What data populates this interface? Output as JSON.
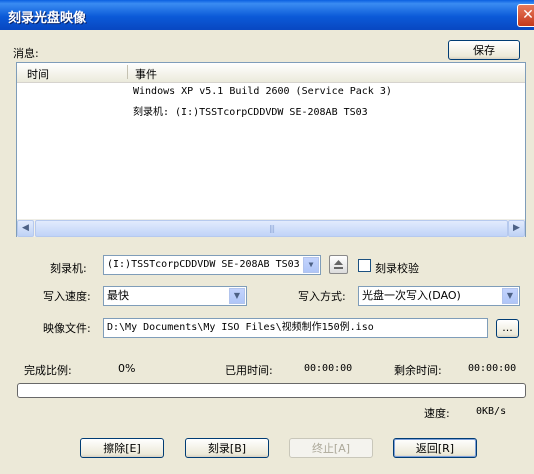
{
  "window": {
    "title": "刻录光盘映像",
    "close_glyph": "✕"
  },
  "messages": {
    "label": "消息:",
    "save_button": "保存",
    "columns": [
      "时间",
      "事件"
    ],
    "rows": [
      "Windows XP v5.1 Build 2600 (Service Pack 3)",
      "刻录机: (I:)TSSTcorpCDDVDW SE-208AB TS03"
    ]
  },
  "burner": {
    "label": "刻录机:",
    "value": "(I:)TSSTcorpCDDVDW SE-208AB TS03",
    "verify_label": "刻录校验",
    "verify_checked": false
  },
  "speed": {
    "label": "写入速度:",
    "value": "最快"
  },
  "write_mode": {
    "label": "写入方式:",
    "value": "光盘一次写入(DAO)"
  },
  "image_file": {
    "label": "映像文件:",
    "value": "D:\\My Documents\\My ISO Files\\视频制作150例.iso",
    "browse_label": "..."
  },
  "status": {
    "progress_label": "完成比例:",
    "progress_value": "0%",
    "elapsed_label": "已用时间:",
    "elapsed_value": "00:00:00",
    "remaining_label": "剩余时间:",
    "remaining_value": "00:00:00",
    "speed_label": "速度:",
    "speed_value": "0KB/s",
    "progress_fraction": 0
  },
  "buttons": {
    "erase": "擦除[E]",
    "burn": "刻录[B]",
    "stop": "终止[A]",
    "back": "返回[R]"
  },
  "colors": {
    "titlebar": "#0b5ad8",
    "dialog_bg": "#ece9d8"
  }
}
